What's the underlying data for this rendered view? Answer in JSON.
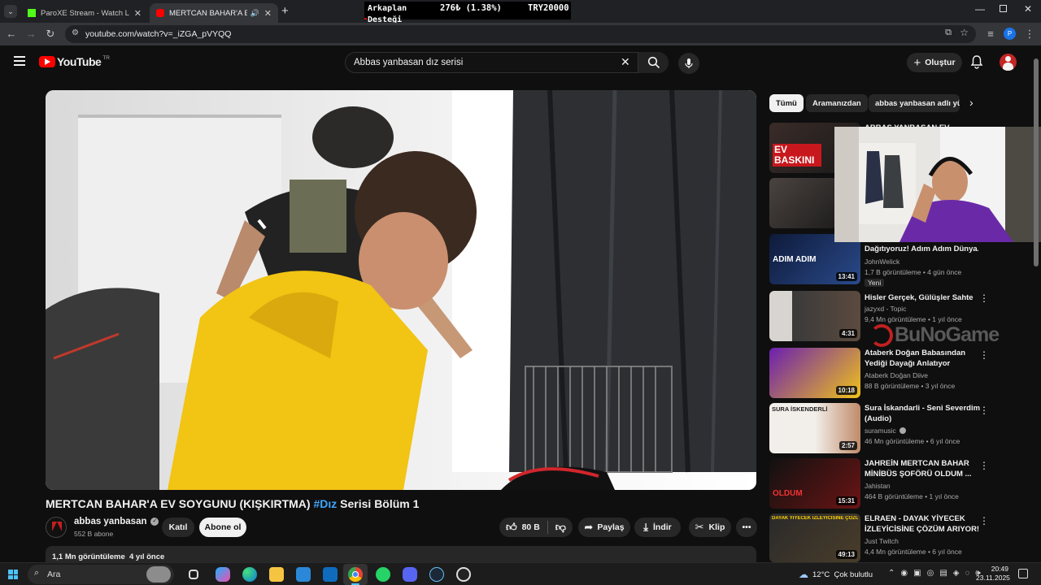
{
  "browser": {
    "tabs": [
      {
        "title": "ParoXE Stream - Watch Live on",
        "active": false
      },
      {
        "title": "MERTCAN BAHAR'A EV SOY",
        "active": true
      }
    ],
    "url": "youtube.com/watch?v=_iZGA_pVYQQ"
  },
  "donation_overlay": {
    "label": "Arkaplan Desteği",
    "amount": "276₺ (1.38%)",
    "goal": "TRY20000"
  },
  "youtube": {
    "logo": "YouTube",
    "region": "TR",
    "search_value": "Abbas yanbasan dız serisi",
    "create_label": "Oluştur"
  },
  "video": {
    "title_main": "MERTCAN BAHAR'A EV SOYGUNU (KIŞKIRTMA) ",
    "title_tag": "#Dız",
    "title_rest": " Serisi Bölüm 1",
    "channel": "abbas yanbasan",
    "subscribers": "552 B abone",
    "join_label": "Katıl",
    "subscribe_label": "Abone ol",
    "likes": "80 B",
    "share_label": "Paylaş",
    "download_label": "İndir",
    "clip_label": "Klip",
    "views_line": "1,1 Mn görüntüleme  4 yıl önce"
  },
  "chips": [
    "Tümü",
    "Aramanızdan",
    "abbas yanbasan adlı yük"
  ],
  "recommendations": [
    {
      "title": "ABBAS YANBASAN EV BASKINI",
      "channel": "",
      "meta": "",
      "duration": "",
      "thumb_text": "EV BASKINI",
      "accent": "#d61f1f"
    },
    {
      "title": "Dağıtıyoruz! Adım Adım Dünya...",
      "channel": "JohnWelick",
      "meta": "1,7 B görüntüleme • 4 gün önce",
      "duration": "13:41",
      "badge": "Yeni",
      "thumb_text": "ADIM ADIM",
      "accent": "#1f3fa0"
    },
    {
      "title": "Hisler Gerçek, Gülüşler Sahte",
      "channel": "jazyxd - Topic",
      "meta": "9,4 Mn görüntüleme • 1 yıl önce",
      "duration": "4:31",
      "thumb_text": "",
      "accent": "#8a7d6f"
    },
    {
      "title": "Ataberk Doğan Babasından Yediği Dayağı Anlatıyor (Babas...",
      "channel": "Ataberk Doğan Diive",
      "meta": "88 B görüntüleme • 3 yıl önce",
      "duration": "10:18",
      "thumb_text": "",
      "accent": "#7b2fbf"
    },
    {
      "title": "Sura İskandarli - Seni Severdim (Audio)",
      "channel": "suramusic",
      "meta": "46 Mn görüntüleme • 6 yıl önce",
      "duration": "2:57",
      "thumb_text": "SURA İSKENDERLİ",
      "accent": "#e9e3dc"
    },
    {
      "title": "JAHREİN MERTCAN BAHAR MİNİBÜS ŞOFÖRÜ OLDUM ...",
      "channel": "Jahistan",
      "meta": "464 B görüntüleme • 1 yıl önce",
      "duration": "15:31",
      "thumb_text": "OLDUM",
      "accent": "#6b1414"
    },
    {
      "title": "ELRAEN - DAYAK YİYECEK İZLEYİCİSİNE ÇÖZÜM ARIYOR!",
      "channel": "Just Twitch",
      "meta": "4,4 Mn görüntüleme • 6 yıl önce",
      "duration": "49:13",
      "thumb_text": "DAYAK YİYECEK İZLEYİCİSİNE ÇÖZÜM ARIYOR",
      "accent": "#2b2b2b"
    }
  ],
  "watermark": "BuNoGame",
  "taskbar": {
    "search_label": "Ara",
    "weather": "12°C  Çok bulutlu",
    "time": "20:49",
    "date": "23.11.2025"
  }
}
